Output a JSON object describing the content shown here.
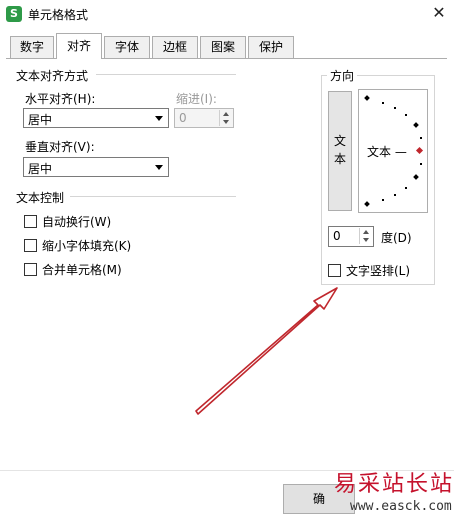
{
  "window": {
    "title": "单元格格式",
    "app_icon": "S",
    "close_icon": "close-icon"
  },
  "tabs": [
    {
      "label": "数字"
    },
    {
      "label": "对齐"
    },
    {
      "label": "字体"
    },
    {
      "label": "边框"
    },
    {
      "label": "图案"
    },
    {
      "label": "保护"
    }
  ],
  "active_tab": "对齐",
  "alignment": {
    "group_title": "文本对齐方式",
    "horizontal_label": "水平对齐(H):",
    "horizontal_value": "居中",
    "indent_label": "缩进(I):",
    "indent_value": "0",
    "vertical_label": "垂直对齐(V):",
    "vertical_value": "居中"
  },
  "text_control": {
    "group_title": "文本控制",
    "options": [
      {
        "label": "自动换行(W)",
        "checked": false
      },
      {
        "label": "缩小字体填充(K)",
        "checked": false
      },
      {
        "label": "合并单元格(M)",
        "checked": false
      }
    ]
  },
  "orientation": {
    "group_title": "方向",
    "vertical_text": "文本",
    "dial_text": "文本 —",
    "degrees_value": "0",
    "degrees_label": "度(D)",
    "vertical_checkbox_label": "文字竖排(L)",
    "vertical_checkbox_checked": false
  },
  "buttons": {
    "ok_label": "确"
  },
  "watermark": {
    "text": "易采站长站",
    "url": "www.easck.com"
  },
  "colors": {
    "accent_arrow": "#c0272d",
    "dial_marker": "#c0272d"
  }
}
